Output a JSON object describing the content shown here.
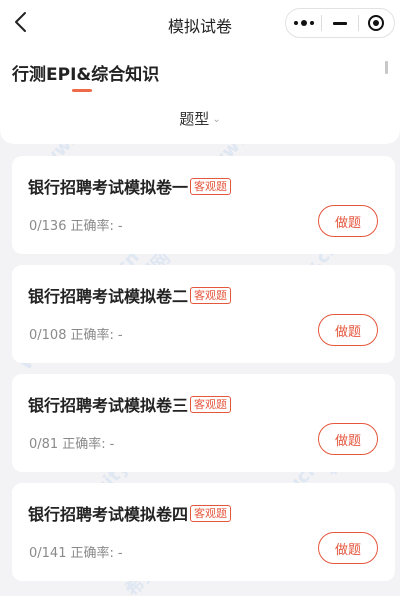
{
  "header": {
    "title": "模拟试卷",
    "back_icon": "chevron-left-icon",
    "more_icon": "more-dots-icon",
    "minimize_icon": "minus-icon",
    "close_icon": "target-icon"
  },
  "subject_tab": {
    "label": "行测EPI&综合知识",
    "active_color": "#f06a4a"
  },
  "filter": {
    "label": "题型",
    "chevron": "⌄"
  },
  "papers": [
    {
      "title": "银行招聘考试模拟卷一",
      "tag": "客观题",
      "progress": "0/136",
      "accuracy_label": "正确率:",
      "accuracy_value": "-",
      "button_label": "做题"
    },
    {
      "title": "银行招聘考试模拟卷二",
      "tag": "客观题",
      "progress": "0/108",
      "accuracy_label": "正确率:",
      "accuracy_value": "-",
      "button_label": "做题"
    },
    {
      "title": "银行招聘考试模拟卷三",
      "tag": "客观题",
      "progress": "0/81",
      "accuracy_label": "正确率:",
      "accuracy_value": "-",
      "button_label": "做题"
    },
    {
      "title": "银行招聘考试模拟卷四",
      "tag": "客观题",
      "progress": "0/141",
      "accuracy_label": "正确率:",
      "accuracy_value": "-",
      "button_label": "做题"
    }
  ],
  "watermark": {
    "brand": "希赛网",
    "url": "www.educity.cn"
  },
  "colors": {
    "accent": "#e5573d",
    "background": "#f3f3f5"
  }
}
